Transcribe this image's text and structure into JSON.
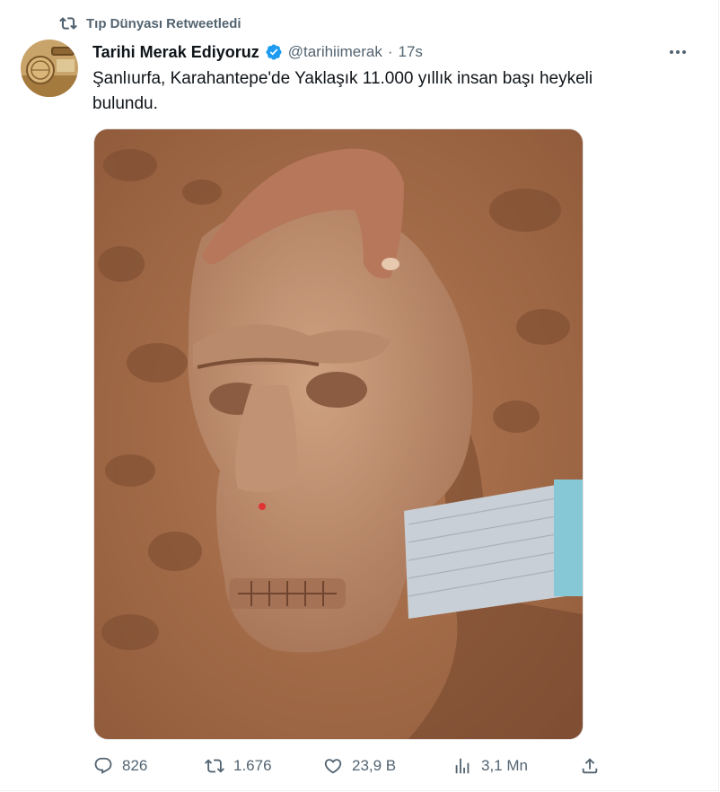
{
  "retweet": {
    "icon": "retweet-icon",
    "label": "Tıp Dünyası Retweetledi"
  },
  "tweet": {
    "author_name": "Tarihi Merak Ediyoruz",
    "verified": true,
    "handle": "@tarihiimerak",
    "separator": "·",
    "time": "17s",
    "text": "Şanlıurfa, Karahantepe'de Yaklaşık 11.000 yıllık insan başı heykeli bulundu.",
    "more_icon": "more-icon",
    "media_icon": "photo-stone-head"
  },
  "actions": {
    "replies": "826",
    "retweets": "1.676",
    "likes": "23,9 B",
    "views": "3,1 Mn"
  },
  "colors": {
    "secondary_text": "#536471",
    "verified_blue": "#1d9bf0",
    "primary_text": "#0f1419"
  }
}
